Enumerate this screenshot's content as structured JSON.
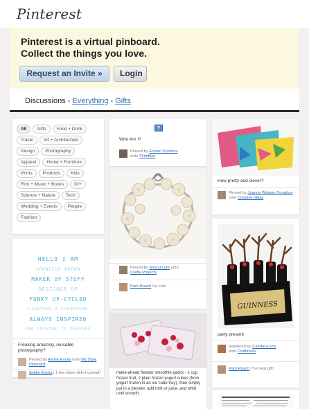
{
  "header": {
    "logo": "Pinterest"
  },
  "hero": {
    "line1": "Pinterest is a virtual pinboard.",
    "line2": "Collect the things you love.",
    "invite_label": "Request an Invite »",
    "login_label": "Login"
  },
  "subnav": {
    "prefix": "Discussions - ",
    "link1": "Everything",
    "sep": " - ",
    "link2": "Gifts"
  },
  "categories": [
    "All",
    "Gifts",
    "Food + Drink",
    "Travel",
    "Art + Architecture",
    "Design",
    "Photography",
    "Apparel",
    "Home + Furniture",
    "Prints",
    "Products",
    "Kids",
    "Film + Music + Books",
    "DIY",
    "Science + Nature",
    "Tech",
    "Wedding + Events",
    "People",
    "Fashion"
  ],
  "pins": {
    "text_art": {
      "lines": [
        "HELLO I AM",
        "JENNIFER BROWN",
        "MAKER OF STUFF",
        "DESIGNER OF",
        "FUNKY UP-CYCLED",
        "LIGHTING & FURNITURE",
        "ALWAYS INSPIRED",
        "AND SEEKING TO INSPIRE"
      ],
      "caption": "Freaking amazing, reusable photography?",
      "pinned_by": "Pinned by",
      "user": "Ashlie Ericka",
      "onto": "onto",
      "board": "My Style Pinboard",
      "comment_user": "Ashlie Ericka",
      "comment": "i 1 the photo didn't upload!"
    },
    "who_am_i": {
      "caption": "Who Am I?",
      "pinned_by": "Pinned by",
      "user": "Eclsen Uyotruru",
      "onto": "onto",
      "board": "Thimbles"
    },
    "bracelet": {
      "pinned_by": "Pinned by",
      "user": "Sheryl Lohr",
      "onto": "onto",
      "board": "Crafty Projects",
      "comment_user": "Pam Roach",
      "comment": "So cute"
    },
    "smoothie": {
      "caption": "make-ahead freezer smoothie packs - 1 cup frozen fruit, 2 plain frozen yogurt cubes (from yogurt frozen in an ice cube tray), then simply put in a blender, add milk or juice, and whirl until smooth."
    },
    "pillow": {
      "caption": "How pretty and clever?",
      "pinned_by": "Pinned by",
      "user": "Joanne Watson Donahue",
      "onto": "onto",
      "board": "Creative Ideas"
    },
    "beer": {
      "caption": "party present",
      "pinned_by": "Repinned by",
      "user": "Candace Fox",
      "onto": "onto",
      "board": "Craftiness",
      "comment_user": "Pam Roach",
      "comment": "The best gift!"
    }
  },
  "colors": {
    "accent": "#2a6db6",
    "hero_bg": "#fbf8df",
    "page_bg": "#f2f0f0",
    "text_art": "#3aa8d3"
  }
}
